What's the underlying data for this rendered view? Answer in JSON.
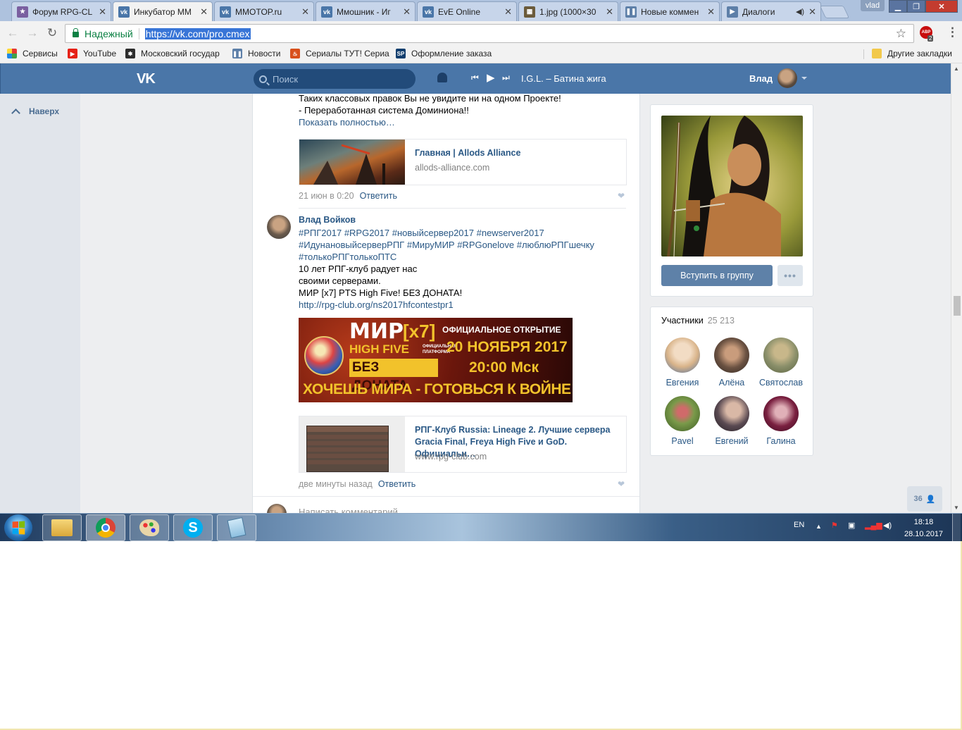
{
  "browser": {
    "tabs": [
      {
        "title": "Форум RPG-CL",
        "color": "#6b5b95",
        "active": false
      },
      {
        "title": "Инкубатор ММ",
        "color": "#4a76a8",
        "active": true
      },
      {
        "title": "MMOTOP.ru",
        "color": "#4a76a8",
        "active": false
      },
      {
        "title": "Ммошник - Иг",
        "color": "#4a76a8",
        "active": false
      },
      {
        "title": "EvE Online",
        "color": "#4a76a8",
        "active": false
      },
      {
        "title": "1.jpg (1000×30",
        "color": "#6b5b3b",
        "active": false
      },
      {
        "title": "Новые коммен",
        "color": "#4a76a8",
        "active": false
      },
      {
        "title": "Диалоги",
        "color": "#4a76a8",
        "active": false
      }
    ],
    "user_badge": "vlad",
    "address": {
      "secure_label": "Надежный",
      "url": "https://vk.com/pro.cmex"
    },
    "abp_label": "ABP",
    "abp_count": "2",
    "bookmarks": [
      {
        "label": "Сервисы",
        "icon": "apps-grid-icon"
      },
      {
        "label": "YouTube",
        "icon": "youtube-icon"
      },
      {
        "label": "Московский государ",
        "icon": "emblem-icon"
      },
      {
        "label": "Новости",
        "icon": "pause-icon"
      },
      {
        "label": "Сериалы ТУТ! Сериа",
        "icon": "flame-icon"
      },
      {
        "label": "Оформление заказа",
        "icon": "sp-icon"
      }
    ],
    "other_bookmarks": "Другие закладки"
  },
  "vk": {
    "logo": "VK",
    "search_placeholder": "Поиск",
    "track": "I.G.L. – Батина жига",
    "user": "Влад",
    "back_to_top": "Наверх"
  },
  "feed": {
    "post1": {
      "lines": [
        "Таких классовых правок Вы не увидите ни на одном Проекте!",
        "- Переработанная система Доминиона!!"
      ],
      "show_more": "Показать полностью…",
      "snippet_title": "Главная | Allods Alliance",
      "snippet_domain": "allods-alliance.com",
      "time": "21 июн в 0:20",
      "reply": "Ответить"
    },
    "post2": {
      "author": "Влад Войков",
      "hashtags": [
        "#РПГ2017 #RPG2017 #новыйсервер2017 #newserver2017",
        "#ИдунановыйсерверРПГ #МируМИР #RPGonelove #люблюРПГшечку",
        "#толькоРПГтолькоПТС"
      ],
      "lines": [
        "10 лет РПГ-клуб радует нас",
        "своими серверами.",
        "МИР [x7] PTS High Five! БЕЗ ДОНАТА!"
      ],
      "link": "http://rpg-club.org/ns2017hfcontestpr1",
      "banner": {
        "title": "МИР",
        "rate": "[x7]",
        "subtitle": "HIGH FIVE",
        "platform": "ОФИЦИАЛЬНАЯ ПЛАТФОРМА",
        "nodonate": "БЕЗ ДОНАТА",
        "opening": "ОФИЦИАЛЬНОЕ ОТКРЫТИЕ",
        "date": "20 НОЯБРЯ 2017",
        "time": "20:00 Мск",
        "slogan": "ХОЧЕШЬ МИРА - ГОТОВЬСЯ К ВОЙНЕ"
      },
      "snippet_title_1": "РПГ-Клуб Russia: Lineage 2. Лучшие сервера",
      "snippet_title_2": "Gracia Final, Freya High Five и GoD. Официальн…",
      "snippet_domain": "www.rpg-club.com",
      "time": "две минуты назад",
      "reply": "Ответить"
    },
    "comment_placeholder": "Написать комментарий..."
  },
  "sidebar": {
    "join_button": "Вступить в группу",
    "more_button": "•••",
    "members_title": "Участники",
    "members_count": "25 213",
    "members": [
      {
        "name": "Евгения",
        "color": "#d9c2a8"
      },
      {
        "name": "Алёна",
        "color": "#6b5242"
      },
      {
        "name": "Святослав",
        "color": "#8a8f6a"
      },
      {
        "name": "Pavel",
        "color": "#5b7a3a"
      },
      {
        "name": "Евгений",
        "color": "#5a4a52"
      },
      {
        "name": "Галина",
        "color": "#7a2040"
      }
    ]
  },
  "online_counter": "36",
  "taskbar": {
    "lang": "EN",
    "time": "18:18",
    "date": "28.10.2017"
  }
}
